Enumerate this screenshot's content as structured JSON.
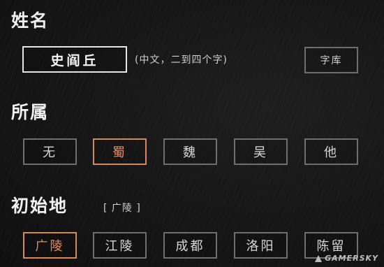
{
  "name_section": {
    "title": "姓名",
    "value": "史阎丘",
    "hint": "(中文，二到四个字)",
    "library_button": "字库"
  },
  "faction_section": {
    "title": "所属",
    "options": [
      "无",
      "蜀",
      "魏",
      "吴",
      "他"
    ],
    "selected": "蜀"
  },
  "origin_section": {
    "title": "初始地",
    "current": "[ 广陵 ]",
    "options": [
      "广陵",
      "江陵",
      "成都",
      "洛阳",
      "陈留"
    ],
    "selected": "广陵"
  },
  "watermark": "GAMERSKY",
  "colors": {
    "accent": "#e88a5a",
    "border": "#6f6f6f",
    "background": "#161616"
  }
}
